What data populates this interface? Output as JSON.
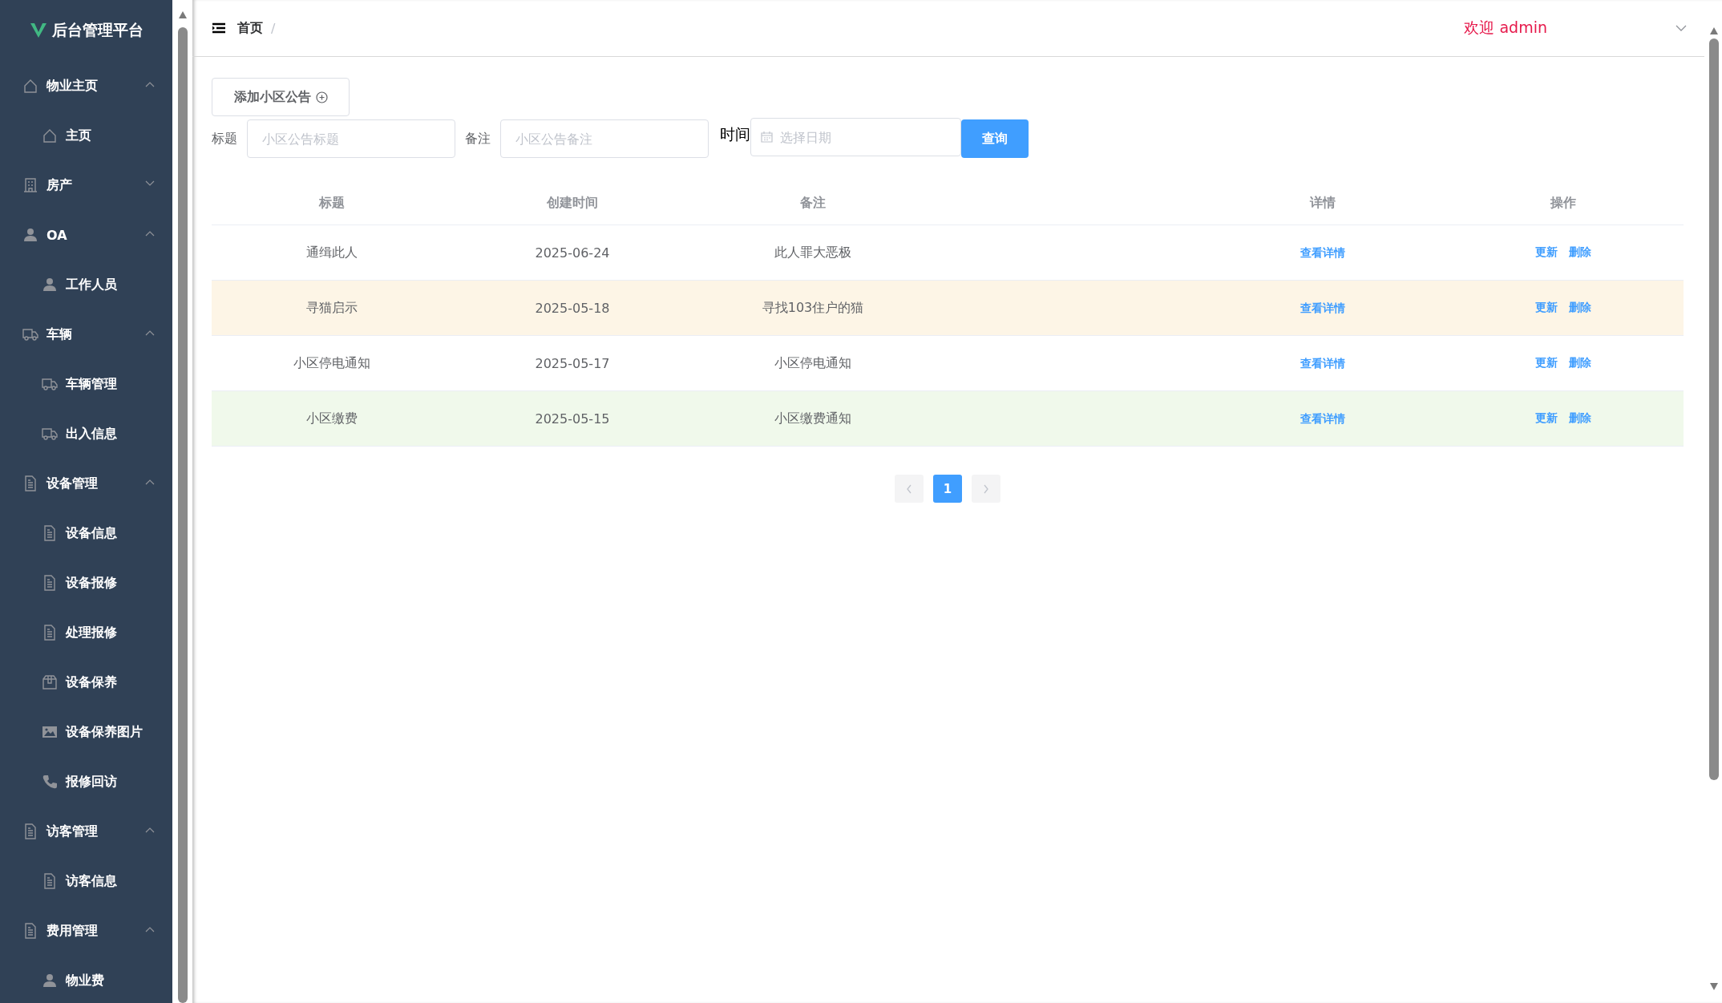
{
  "sidebar": {
    "logo": "后台管理平台",
    "groups": [
      {
        "label": "物业主页",
        "kind": "home",
        "expanded": true,
        "children": [
          {
            "label": "主页",
            "kind": "home"
          }
        ]
      },
      {
        "label": "房产",
        "kind": "building",
        "expanded": false
      },
      {
        "label": "OA",
        "kind": "user",
        "expanded": true,
        "children": [
          {
            "label": "工作人员",
            "kind": "user"
          }
        ]
      },
      {
        "label": "车辆",
        "kind": "truck",
        "expanded": true,
        "children": [
          {
            "label": "车辆管理",
            "kind": "truck"
          },
          {
            "label": "出入信息",
            "kind": "truck"
          }
        ]
      },
      {
        "label": "设备管理",
        "kind": "document",
        "expanded": true,
        "children": [
          {
            "label": "设备信息",
            "kind": "document"
          },
          {
            "label": "设备报修",
            "kind": "document"
          },
          {
            "label": "处理报修",
            "kind": "document"
          },
          {
            "label": "设备保养",
            "kind": "box"
          },
          {
            "label": "设备保养图片",
            "kind": "image"
          },
          {
            "label": "报修回访",
            "kind": "phone"
          }
        ]
      },
      {
        "label": "访客管理",
        "kind": "document",
        "expanded": true,
        "children": [
          {
            "label": "访客信息",
            "kind": "document"
          }
        ]
      },
      {
        "label": "费用管理",
        "kind": "document",
        "expanded": true,
        "children": [
          {
            "label": "物业费",
            "kind": "user"
          }
        ]
      }
    ]
  },
  "header": {
    "breadcrumb": "首页",
    "separator": "/",
    "welcome": "欢迎 admin"
  },
  "toolbar": {
    "add_button": "添加小区公告",
    "filters": [
      {
        "label": "标题",
        "placeholder": "小区公告标题"
      },
      {
        "label": "备注",
        "placeholder": "小区公告备注"
      }
    ],
    "date": {
      "label": "时间",
      "placeholder": "选择日期"
    },
    "search_button": "查询"
  },
  "table": {
    "columns": [
      "标题",
      "创建时间",
      "备注",
      "详情",
      "操作"
    ],
    "rows": [
      {
        "title": "通缉此人",
        "created": "2025-06-24",
        "note": "此人罪大恶极",
        "detail": "查看详情",
        "actions": [
          "更新",
          "删除"
        ],
        "color": "#ffffff"
      },
      {
        "title": "寻猫启示",
        "created": "2025-05-18",
        "note": "寻找103住户的猫",
        "detail": "查看详情",
        "actions": [
          "更新",
          "删除"
        ],
        "color": "#fdf5e6"
      },
      {
        "title": "小区停电通知",
        "created": "2025-05-17",
        "note": "小区停电通知",
        "detail": "查看详情",
        "actions": [
          "更新",
          "删除"
        ],
        "color": "#ffffff"
      },
      {
        "title": "小区缴费",
        "created": "2025-05-15",
        "note": "小区缴费通知",
        "detail": "查看详情",
        "actions": [
          "更新",
          "删除"
        ],
        "color": "#f0f9eb"
      }
    ]
  },
  "pagination": {
    "pages": [
      {
        "label": "1",
        "selected": true
      }
    ]
  }
}
